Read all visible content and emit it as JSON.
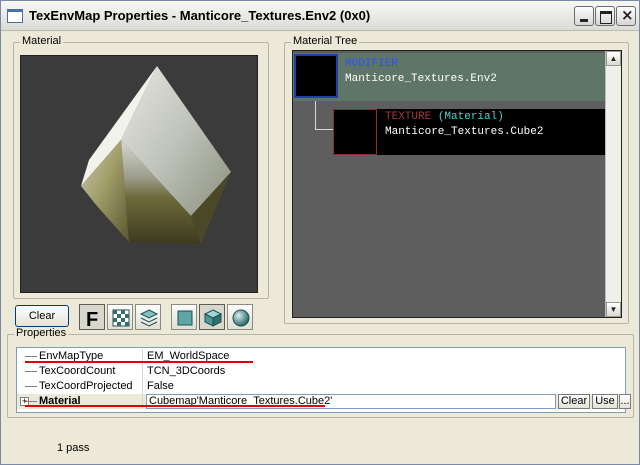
{
  "window": {
    "title": "TexEnvMap Properties - Manticore_Textures.Env2 (0x0)",
    "close_glyph": "×"
  },
  "material": {
    "group_label": "Material",
    "clear_label": "Clear",
    "toolbar": {
      "font_button_glyph": "F",
      "icons": [
        "font-icon",
        "checker-icon",
        "layers-icon",
        "plane-shape-icon",
        "cube-shape-icon",
        "sphere-shape-icon"
      ]
    }
  },
  "tree": {
    "group_label": "Material Tree",
    "modifier": {
      "type_label": "MODIFIER",
      "name": "Manticore_Textures.Env2"
    },
    "texture": {
      "type_label": "TEXTURE",
      "type_suffix": "(Material)",
      "name": "Manticore_Textures.Cube2"
    }
  },
  "properties": {
    "group_label": "Properties",
    "rows": [
      {
        "name": "EnvMapType",
        "value": "EM_WorldSpace"
      },
      {
        "name": "TexCoordCount",
        "value": "TCN_3DCoords"
      },
      {
        "name": "TexCoordProjected",
        "value": "False"
      },
      {
        "name": "Material",
        "value": "Cubemap'Manticore_Textures.Cube2'"
      }
    ],
    "expand_glyph": "+",
    "clear_label": "Clear",
    "use_label": "Use",
    "browse_label": "..."
  },
  "status": {
    "text": "1 pass"
  },
  "colors": {
    "modifier_type": "#2e4fff",
    "texture_type": "#9b3b3b",
    "texture_suffix": "#4fd0d0",
    "annotation_red": "#e00000"
  }
}
